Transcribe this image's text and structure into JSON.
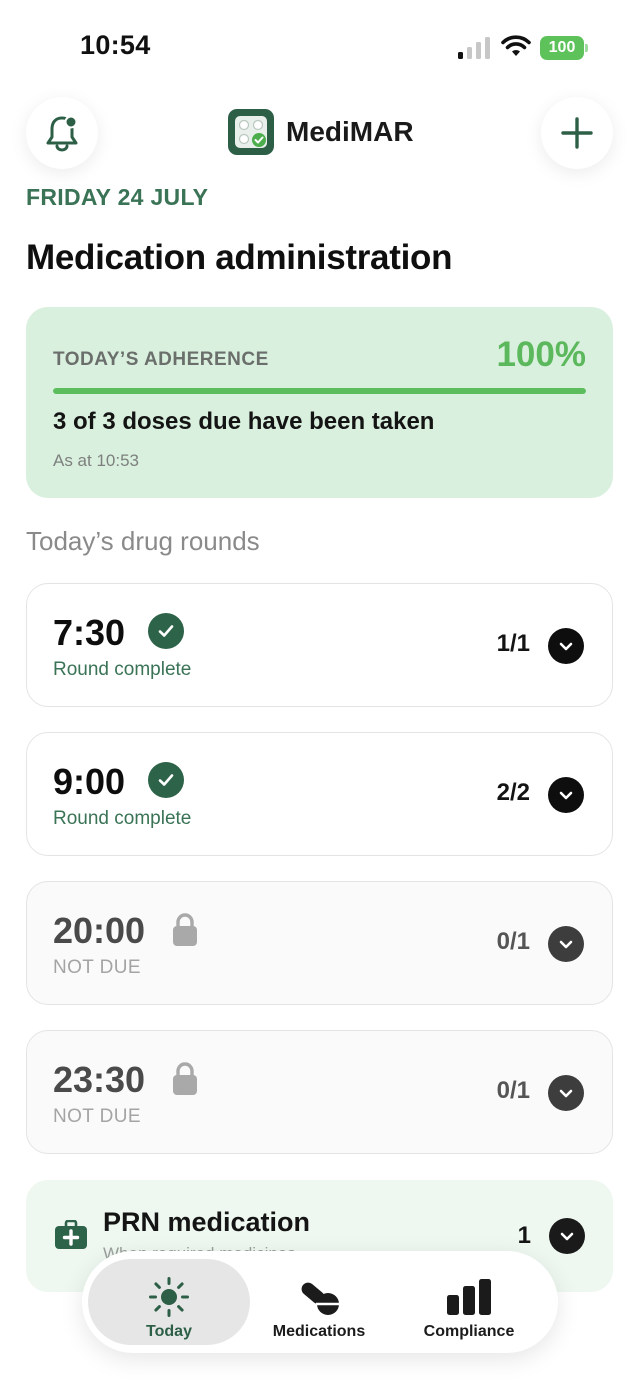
{
  "status_bar": {
    "time": "10:54",
    "battery": "100"
  },
  "header": {
    "app_name": "MediMAR"
  },
  "date_label": "FRIDAY 24 JULY",
  "page_title": "Medication administration",
  "adherence": {
    "label": "TODAY’S ADHERENCE",
    "percent": "100%",
    "progress": 1.0,
    "summary": "3 of 3 doses due have been taken",
    "as_at": "As at 10:53"
  },
  "section_title": "Today’s drug rounds",
  "rounds": [
    {
      "time": "7:30",
      "status": "Round complete",
      "count": "1/1",
      "state": "complete"
    },
    {
      "time": "9:00",
      "status": "Round complete",
      "count": "2/2",
      "state": "complete"
    },
    {
      "time": "20:00",
      "status": "NOT DUE",
      "count": "0/1",
      "state": "locked"
    },
    {
      "time": "23:30",
      "status": "NOT DUE",
      "count": "0/1",
      "state": "locked"
    }
  ],
  "prn": {
    "title": "PRN medication",
    "subtitle": "When required medicines",
    "count": "1"
  },
  "tabs": [
    {
      "label": "Today",
      "icon": "sun-icon",
      "active": true
    },
    {
      "label": "Medications",
      "icon": "pills-icon",
      "active": false
    },
    {
      "label": "Compliance",
      "icon": "bar-chart-icon",
      "active": false
    }
  ],
  "colors": {
    "brand": "#2d5f47",
    "accent_green": "#5cb85c",
    "adherence_bg": "#daf0de"
  }
}
